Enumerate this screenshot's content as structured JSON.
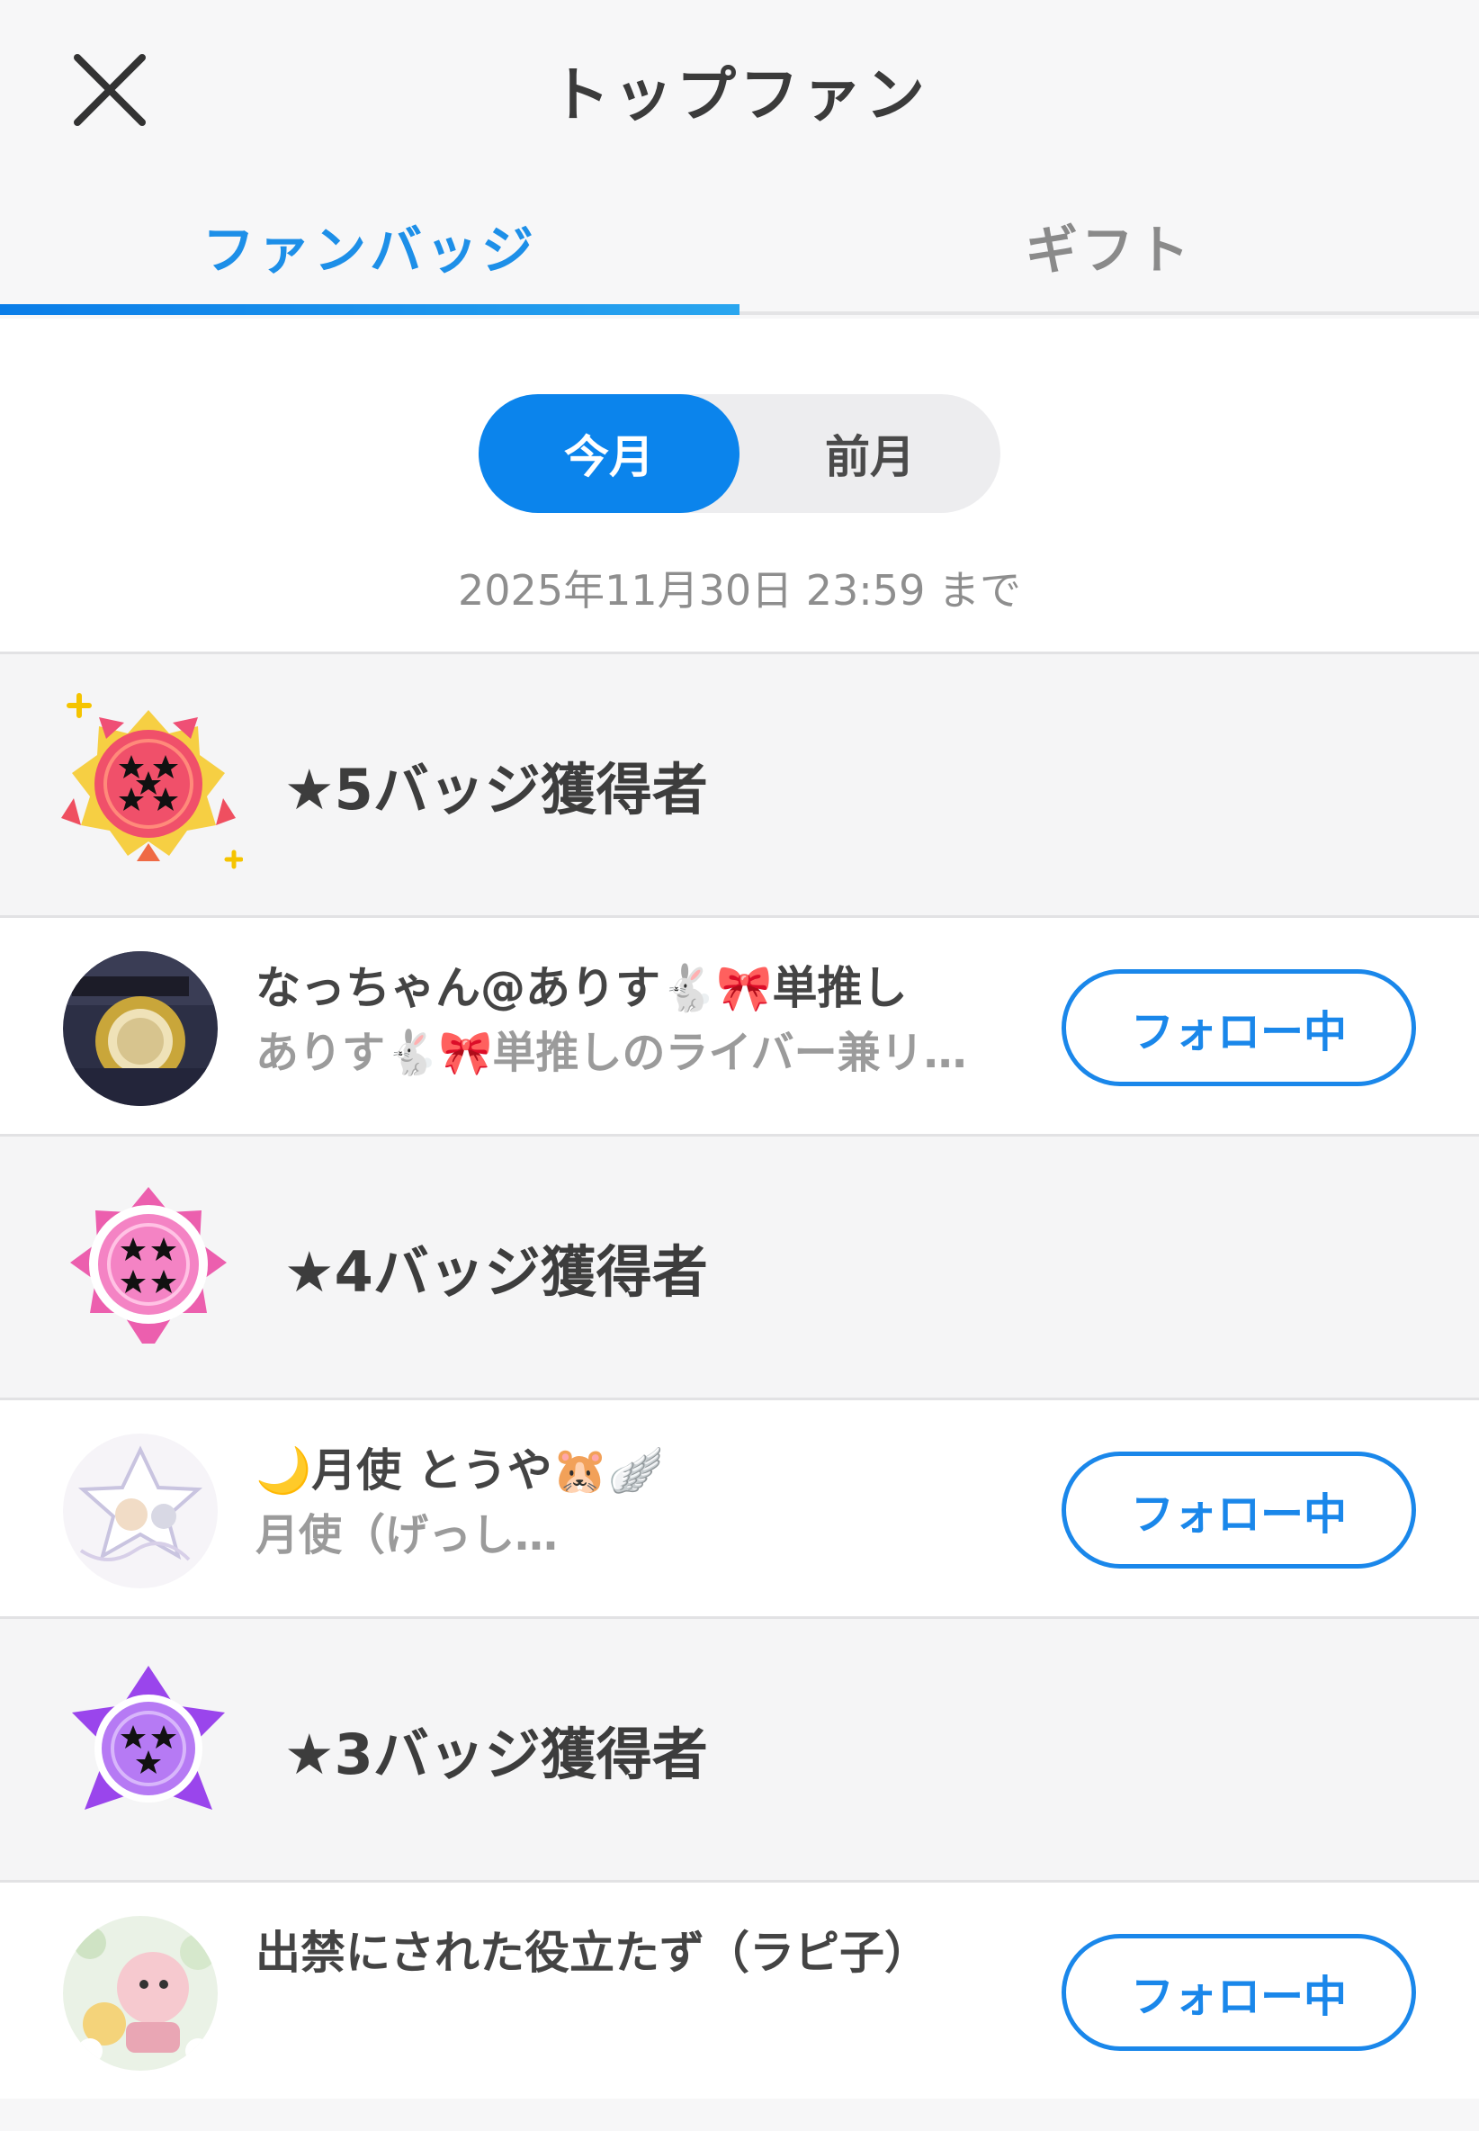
{
  "header": {
    "title": "トップファン",
    "close_icon": "close-icon"
  },
  "tabs": [
    {
      "label": "ファンバッジ",
      "active": true
    },
    {
      "label": "ギフト",
      "active": false
    }
  ],
  "period": {
    "options": [
      {
        "label": "今月",
        "selected": true
      },
      {
        "label": "前月",
        "selected": false
      }
    ],
    "deadline": "2025年11月30日 23:59 まで"
  },
  "tiers": [
    {
      "label": "★5バッジ獲得者",
      "badge_icon": "five-star-badge-icon",
      "user": {
        "name": "なっちゃん@ありす🐇🎀単推し",
        "bio": "ありす🐇🎀単推しのライバー兼リ…",
        "button": "フォロー中"
      }
    },
    {
      "label": "★4バッジ獲得者",
      "badge_icon": "four-star-badge-icon",
      "user": {
        "name": "🌙月使 とうや🐹🪽",
        "bio": "月使（げっし…",
        "button": "フォロー中"
      }
    },
    {
      "label": "★3バッジ獲得者",
      "badge_icon": "three-star-badge-icon",
      "user": {
        "name": "出禁にされた役立たず（ラピ子）",
        "bio": "",
        "button": "フォロー中"
      }
    }
  ],
  "colors": {
    "accent": "#0b84ec",
    "tier5": "#f0506a",
    "tier4": "#ef6fb6",
    "tier3": "#a35ef0"
  }
}
